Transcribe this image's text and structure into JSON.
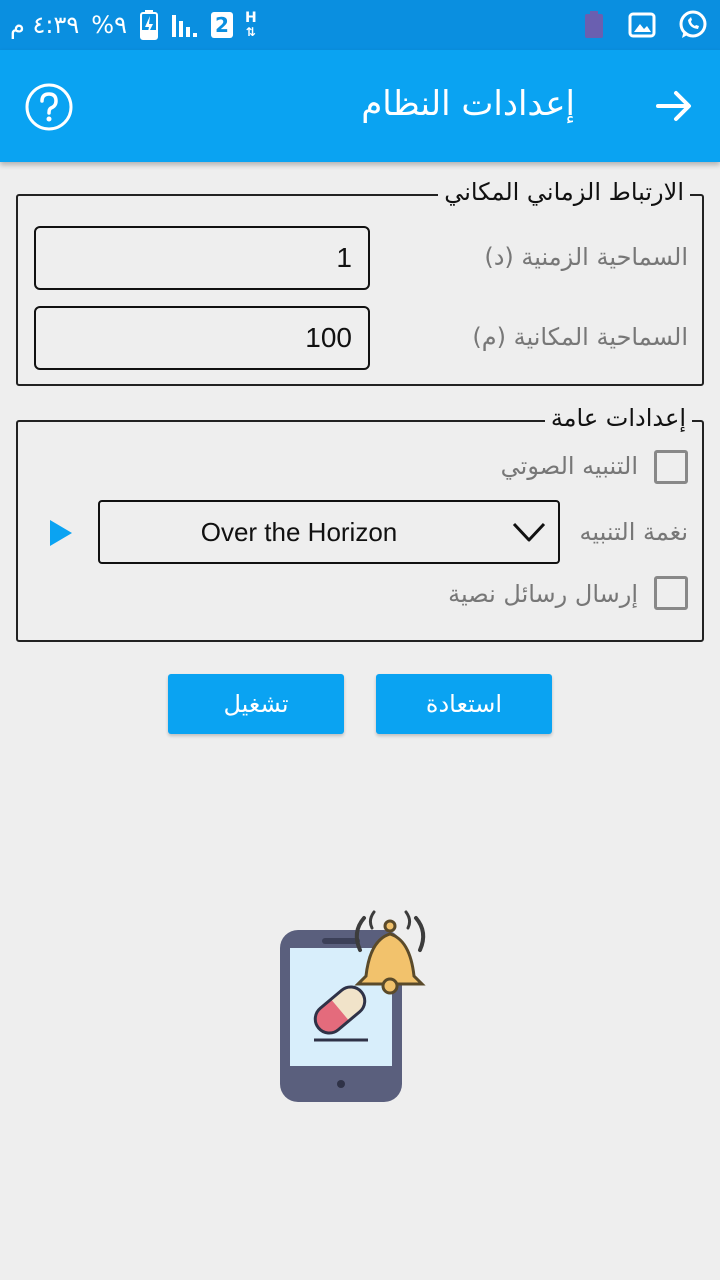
{
  "status_bar": {
    "time": "٤:٣٩ م",
    "battery": "%٩",
    "sim": "2",
    "network": "H"
  },
  "app_bar": {
    "title": "إعدادات النظام"
  },
  "spatiotemporal": {
    "legend": "الارتباط الزماني المكاني",
    "time_tolerance_label": "السماحية الزمنية (د)",
    "time_tolerance_value": "1",
    "space_tolerance_label": "السماحية المكانية (م)",
    "space_tolerance_value": "100"
  },
  "general": {
    "legend": "إعدادات عامة",
    "sound_alert_label": "التنبيه الصوتي",
    "sound_alert_checked": false,
    "ringtone_label": "نغمة التنبيه",
    "ringtone_value": "Over the Horizon",
    "sms_label": "إرسال رسائل نصية",
    "sms_checked": false
  },
  "buttons": {
    "restore": "استعادة",
    "run": "تشغيل"
  },
  "colors": {
    "primary": "#0aa3f2",
    "status_bar": "#0a8fe0"
  }
}
